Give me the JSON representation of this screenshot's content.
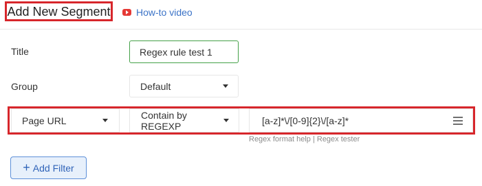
{
  "header": {
    "title": "Add New Segment",
    "howto_label": "How-to video",
    "howto_icon": "youtube-play-icon"
  },
  "form": {
    "title_label": "Title",
    "title_value": "Regex rule test 1",
    "group_label": "Group",
    "group_value": "Default"
  },
  "filter": {
    "field": "Page URL",
    "condition": "Contain by REGEXP",
    "value": "[a-z]*\\/[0-9]{2}\\/[a-z]*",
    "menu_icon": "hamburger-menu-icon",
    "help": {
      "format_help": "Regex format help",
      "separator": "|",
      "tester": "Regex tester"
    }
  },
  "actions": {
    "add_filter_label": "Add Filter",
    "add_filter_icon": "+"
  },
  "colors": {
    "highlight": "#d7262b",
    "link": "#3b73c7",
    "active_input_border": "#43a047",
    "button_bg": "#e7f0fb",
    "button_border": "#5c8fd8"
  }
}
